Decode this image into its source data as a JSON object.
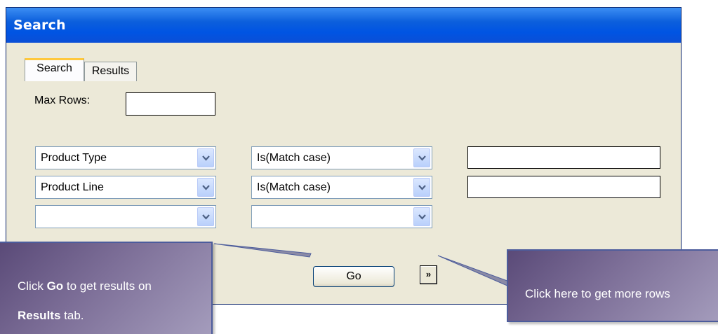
{
  "window": {
    "title": "Search"
  },
  "tabs": [
    {
      "label": "Search",
      "active": true
    },
    {
      "label": "Results",
      "active": false
    }
  ],
  "max_rows": {
    "label": "Max Rows:",
    "value": ""
  },
  "criteria": [
    {
      "field": "Product Type",
      "operator": "Is(Match case)",
      "value": ""
    },
    {
      "field": "Product Line",
      "operator": "Is(Match case)",
      "value": ""
    },
    {
      "field": "",
      "operator": ""
    }
  ],
  "buttons": {
    "go": "Go",
    "more": "»"
  },
  "callouts": {
    "left": {
      "line1_prefix": "Click ",
      "line1_bold": "Go",
      "line1_suffix": " to get results on",
      "line2_bold": "Results",
      "line2_suffix": " tab."
    },
    "right": {
      "text": "Click here to get more rows"
    }
  },
  "colors": {
    "titlebar": "#0054e3",
    "window_bg": "#ece9d8",
    "callout": "#7d6f98",
    "tab_highlight": "#ffc83c"
  },
  "icons": {
    "dropdown": "chevron-down-icon",
    "more_rows": "double-chevron-right-icon"
  }
}
